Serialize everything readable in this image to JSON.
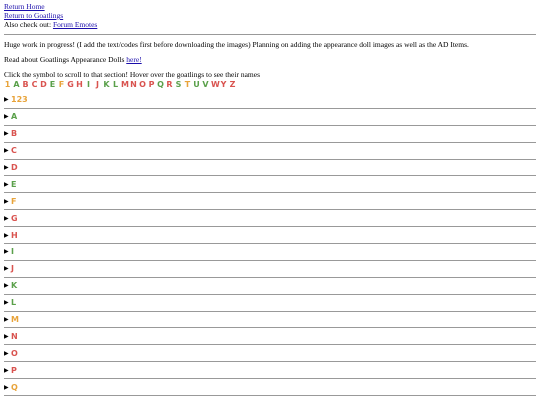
{
  "nav": {
    "return_home": "Return Home",
    "return_goatlings": "Return to Goatlings",
    "also_prefix": "Also check out: ",
    "forum_emotes": "Forum Emotes"
  },
  "intro": {
    "progress_text": "Huge work in progress! (I add the text/codes first before downloading the images) Planning on adding the appearance doll images as well as the AD Items.",
    "read_about": "Read about Goatlings Appearance Dolls ",
    "here": "here!",
    "instructions": "Click the symbol to scroll to that section! Hover over the goatlings to see their names"
  },
  "letter_nav": [
    {
      "label": "1",
      "color": "#e8a33a"
    },
    {
      "label": "A",
      "color": "#5aa04a"
    },
    {
      "label": "B",
      "color": "#d9534f"
    },
    {
      "label": "C",
      "color": "#d9534f"
    },
    {
      "label": "D",
      "color": "#d9534f"
    },
    {
      "label": "E",
      "color": "#5aa04a"
    },
    {
      "label": "F",
      "color": "#e8a33a"
    },
    {
      "label": "G",
      "color": "#d9534f"
    },
    {
      "label": "H",
      "color": "#d9534f"
    },
    {
      "label": "I",
      "color": "#5aa04a"
    },
    {
      "label": "J",
      "color": "#d9534f"
    },
    {
      "label": "K",
      "color": "#5aa04a"
    },
    {
      "label": "L",
      "color": "#5aa04a"
    },
    {
      "label": "M",
      "color": "#d9534f"
    },
    {
      "label": "N",
      "color": "#d9534f"
    },
    {
      "label": "O",
      "color": "#d9534f"
    },
    {
      "label": "P",
      "color": "#d9534f"
    },
    {
      "label": "Q",
      "color": "#5aa04a"
    },
    {
      "label": "R",
      "color": "#d9534f"
    },
    {
      "label": "S",
      "color": "#5aa04a"
    },
    {
      "label": "T",
      "color": "#e8a33a"
    },
    {
      "label": "U",
      "color": "#5aa04a"
    },
    {
      "label": "V",
      "color": "#5aa04a"
    },
    {
      "label": "W",
      "color": "#d9534f"
    },
    {
      "label": "Y",
      "color": "#d9534f"
    },
    {
      "label": "Z",
      "color": "#d9534f"
    }
  ],
  "sections": [
    {
      "label": "123",
      "color": "#e8a33a"
    },
    {
      "label": "A",
      "color": "#5aa04a"
    },
    {
      "label": "B",
      "color": "#d9534f"
    },
    {
      "label": "C",
      "color": "#d9534f"
    },
    {
      "label": "D",
      "color": "#d9534f"
    },
    {
      "label": "E",
      "color": "#5aa04a"
    },
    {
      "label": "F",
      "color": "#e8a33a"
    },
    {
      "label": "G",
      "color": "#d9534f"
    },
    {
      "label": "H",
      "color": "#d9534f"
    },
    {
      "label": "I",
      "color": "#5aa04a"
    },
    {
      "label": "J",
      "color": "#d9534f"
    },
    {
      "label": "K",
      "color": "#5aa04a"
    },
    {
      "label": "L",
      "color": "#5aa04a"
    },
    {
      "label": "M",
      "color": "#e8a33a"
    },
    {
      "label": "N",
      "color": "#d9534f"
    },
    {
      "label": "O",
      "color": "#d9534f"
    },
    {
      "label": "P",
      "color": "#d9534f"
    },
    {
      "label": "Q",
      "color": "#e8a33a"
    }
  ]
}
